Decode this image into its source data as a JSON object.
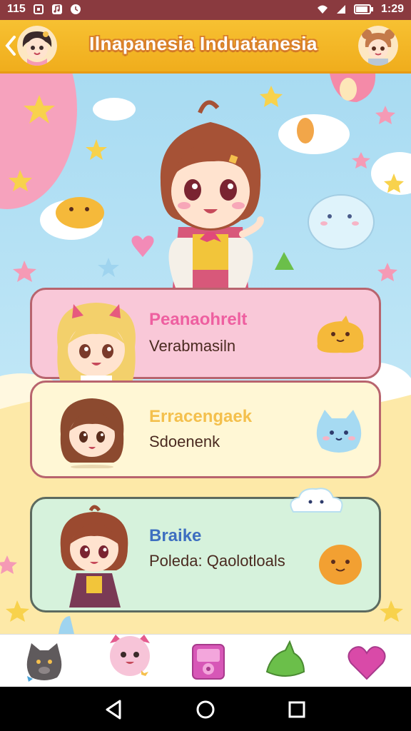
{
  "status_bar": {
    "left_label": "115",
    "left_icons": [
      "notification-square-icon",
      "music-icon",
      "clock-icon"
    ],
    "right_icons": [
      "wifi-icon",
      "signal-icon",
      "battery-icon"
    ],
    "time": "1:29"
  },
  "app_bar": {
    "title": "Ilnapanesia  Induatanesia",
    "back_icon": "chevron-left-icon",
    "left_avatar": "girl-avatar",
    "right_avatar": "bear-avatar"
  },
  "hero": {
    "character": "anime-girl-mascot",
    "decorations": [
      "star",
      "cloud",
      "heart",
      "whale"
    ]
  },
  "cards": [
    {
      "title": "Peanaohrelt",
      "subtitle": "Verabmasiln",
      "title_color": "#ee5fa0",
      "mascot": "yellow-blob-mascot"
    },
    {
      "title": "Erracengaek",
      "subtitle": "Sdoenenk",
      "title_color": "#f4c04d",
      "mascot": "blue-cat-mascot"
    },
    {
      "title": "Braike",
      "subtitle": "Poleda: Qaolotloals",
      "title_color": "#3e6fc0",
      "mascot": "orange-blob-mascot"
    }
  ],
  "bottom_nav": [
    {
      "icon": "cat-face-icon",
      "color": "#5f5a5c"
    },
    {
      "icon": "pink-creature-icon",
      "color": "#f7a7cc"
    },
    {
      "icon": "music-player-icon",
      "color": "#d757b7"
    },
    {
      "icon": "leaf-icon",
      "color": "#6bbf4a"
    },
    {
      "icon": "heart-icon",
      "color": "#d94aa8"
    }
  ],
  "system_nav": [
    "back-triangle-icon",
    "home-circle-icon",
    "recents-square-icon"
  ],
  "colors": {
    "status_bar": "#8a3a3f",
    "app_bar": "#f0ad1c",
    "card_border": "#b8646e"
  }
}
